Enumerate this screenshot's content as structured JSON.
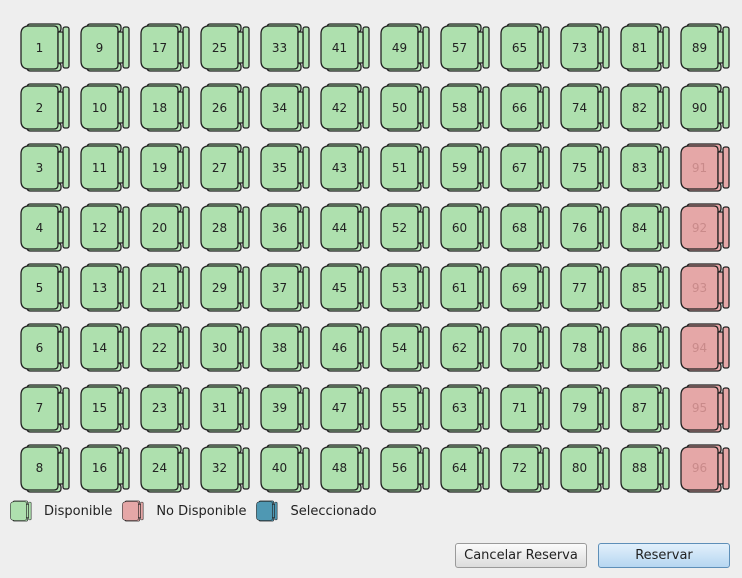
{
  "colors": {
    "available": "#aee0ae",
    "unavailable": "#e5a7a7",
    "selected": "#4f98b3",
    "outline": "#222222"
  },
  "seats": [
    {
      "number": "1",
      "status": "available"
    },
    {
      "number": "9",
      "status": "available"
    },
    {
      "number": "17",
      "status": "available"
    },
    {
      "number": "25",
      "status": "available"
    },
    {
      "number": "33",
      "status": "available"
    },
    {
      "number": "41",
      "status": "available"
    },
    {
      "number": "49",
      "status": "available"
    },
    {
      "number": "57",
      "status": "available"
    },
    {
      "number": "65",
      "status": "available"
    },
    {
      "number": "73",
      "status": "available"
    },
    {
      "number": "81",
      "status": "available"
    },
    {
      "number": "89",
      "status": "available"
    },
    {
      "number": "2",
      "status": "available"
    },
    {
      "number": "10",
      "status": "available"
    },
    {
      "number": "18",
      "status": "available"
    },
    {
      "number": "26",
      "status": "available"
    },
    {
      "number": "34",
      "status": "available"
    },
    {
      "number": "42",
      "status": "available"
    },
    {
      "number": "50",
      "status": "available"
    },
    {
      "number": "58",
      "status": "available"
    },
    {
      "number": "66",
      "status": "available"
    },
    {
      "number": "74",
      "status": "available"
    },
    {
      "number": "82",
      "status": "available"
    },
    {
      "number": "90",
      "status": "available"
    },
    {
      "number": "3",
      "status": "available"
    },
    {
      "number": "11",
      "status": "available"
    },
    {
      "number": "19",
      "status": "available"
    },
    {
      "number": "27",
      "status": "available"
    },
    {
      "number": "35",
      "status": "available"
    },
    {
      "number": "43",
      "status": "available"
    },
    {
      "number": "51",
      "status": "available"
    },
    {
      "number": "59",
      "status": "available"
    },
    {
      "number": "67",
      "status": "available"
    },
    {
      "number": "75",
      "status": "available"
    },
    {
      "number": "83",
      "status": "available"
    },
    {
      "number": "91",
      "status": "unavailable"
    },
    {
      "number": "4",
      "status": "available"
    },
    {
      "number": "12",
      "status": "available"
    },
    {
      "number": "20",
      "status": "available"
    },
    {
      "number": "28",
      "status": "available"
    },
    {
      "number": "36",
      "status": "available"
    },
    {
      "number": "44",
      "status": "available"
    },
    {
      "number": "52",
      "status": "available"
    },
    {
      "number": "60",
      "status": "available"
    },
    {
      "number": "68",
      "status": "available"
    },
    {
      "number": "76",
      "status": "available"
    },
    {
      "number": "84",
      "status": "available"
    },
    {
      "number": "92",
      "status": "unavailable"
    },
    {
      "number": "5",
      "status": "available"
    },
    {
      "number": "13",
      "status": "available"
    },
    {
      "number": "21",
      "status": "available"
    },
    {
      "number": "29",
      "status": "available"
    },
    {
      "number": "37",
      "status": "available"
    },
    {
      "number": "45",
      "status": "available"
    },
    {
      "number": "53",
      "status": "available"
    },
    {
      "number": "61",
      "status": "available"
    },
    {
      "number": "69",
      "status": "available"
    },
    {
      "number": "77",
      "status": "available"
    },
    {
      "number": "85",
      "status": "available"
    },
    {
      "number": "93",
      "status": "unavailable"
    },
    {
      "number": "6",
      "status": "available"
    },
    {
      "number": "14",
      "status": "available"
    },
    {
      "number": "22",
      "status": "available"
    },
    {
      "number": "30",
      "status": "available"
    },
    {
      "number": "38",
      "status": "available"
    },
    {
      "number": "46",
      "status": "available"
    },
    {
      "number": "54",
      "status": "available"
    },
    {
      "number": "62",
      "status": "available"
    },
    {
      "number": "70",
      "status": "available"
    },
    {
      "number": "78",
      "status": "available"
    },
    {
      "number": "86",
      "status": "available"
    },
    {
      "number": "94",
      "status": "unavailable"
    },
    {
      "number": "7",
      "status": "available"
    },
    {
      "number": "15",
      "status": "available"
    },
    {
      "number": "23",
      "status": "available"
    },
    {
      "number": "31",
      "status": "available"
    },
    {
      "number": "39",
      "status": "available"
    },
    {
      "number": "47",
      "status": "available"
    },
    {
      "number": "55",
      "status": "available"
    },
    {
      "number": "63",
      "status": "available"
    },
    {
      "number": "71",
      "status": "available"
    },
    {
      "number": "79",
      "status": "available"
    },
    {
      "number": "87",
      "status": "available"
    },
    {
      "number": "95",
      "status": "unavailable"
    },
    {
      "number": "8",
      "status": "available"
    },
    {
      "number": "16",
      "status": "available"
    },
    {
      "number": "24",
      "status": "available"
    },
    {
      "number": "32",
      "status": "available"
    },
    {
      "number": "40",
      "status": "available"
    },
    {
      "number": "48",
      "status": "available"
    },
    {
      "number": "56",
      "status": "available"
    },
    {
      "number": "64",
      "status": "available"
    },
    {
      "number": "72",
      "status": "available"
    },
    {
      "number": "80",
      "status": "available"
    },
    {
      "number": "88",
      "status": "available"
    },
    {
      "number": "96",
      "status": "unavailable"
    }
  ],
  "legend": {
    "available": "Disponible",
    "unavailable": "No Disponible",
    "selected": "Seleccionado"
  },
  "buttons": {
    "cancel": "Cancelar Reserva",
    "reserve": "Reservar"
  }
}
